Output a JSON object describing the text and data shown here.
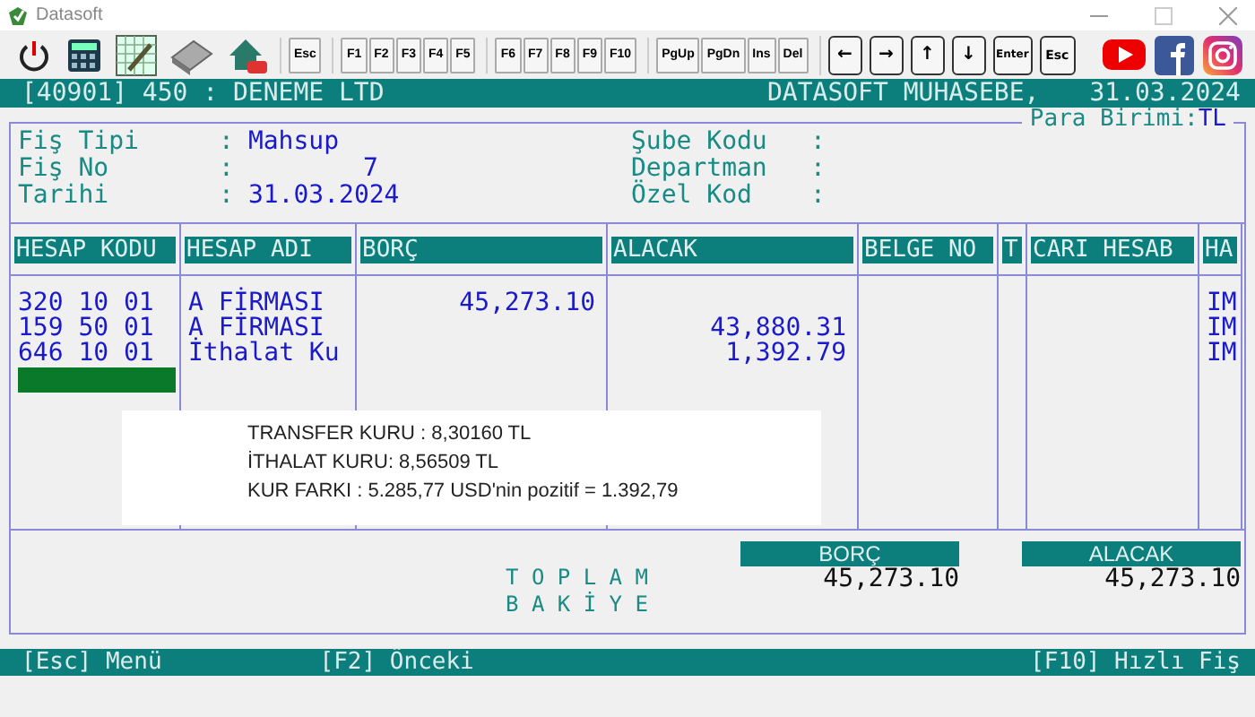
{
  "window": {
    "title": "Datasoft"
  },
  "toolbar": {
    "key_groups": [
      [
        "Esc"
      ],
      [
        "F1",
        "F2",
        "F3",
        "F4",
        "F5"
      ],
      [
        "F6",
        "F7",
        "F8",
        "F9",
        "F10"
      ],
      [
        "PgUp",
        "PgDn",
        "Ins",
        "Del"
      ]
    ],
    "arrow_keys": [
      "←",
      "→",
      "↑",
      "↓"
    ],
    "enter_key": "Enter",
    "esc_key": "Esc"
  },
  "header": {
    "company": "[40901] 450 : DENEME LTD",
    "app": "DATASOFT MUHASEBE,",
    "date": "31.03.2024"
  },
  "currency": {
    "label": "Para Birimi:",
    "value": "TL"
  },
  "fields_left": [
    {
      "label": "Fiş Tipi",
      "separator": ":",
      "value": "Mahsup"
    },
    {
      "label": "Fiş No",
      "separator": ":",
      "value": "7"
    },
    {
      "label": "Tarihi",
      "separator": ":",
      "value": "31.03.2024"
    }
  ],
  "fields_right": [
    {
      "label": "Şube Kodu",
      "separator": ":"
    },
    {
      "label": "Departman",
      "separator": ":"
    },
    {
      "label": "Özel Kod",
      "separator": ":"
    }
  ],
  "table": {
    "columns": [
      "HESAP KODU",
      "HESAP ADI",
      "BORÇ",
      "ALACAK",
      "BELGE NO",
      "T",
      "CARI HESAB",
      "HA"
    ],
    "rows": [
      {
        "hesap_kodu": "320 10 01",
        "hesap_adi": "A FİRMASI",
        "borc": "45,273.10",
        "ha": "IM"
      },
      {
        "hesap_kodu": "159 50 01",
        "hesap_adi": "A FİRMASI",
        "alacak": "43,880.31",
        "ha": "IM"
      },
      {
        "hesap_kodu": "646 10 01",
        "hesap_adi": "İthalat Ku",
        "alacak": "1,392.79",
        "ha": "IM"
      }
    ],
    "new_row_cursor": true
  },
  "note": [
    "TRANSFER KURU : 8,30160 TL",
    "İTHALAT KURU: 8,56509 TL",
    "KUR FARKI : 5.285,77 USD'nin pozitif = 1.392,79"
  ],
  "totals": {
    "label_1": "T O P L A M",
    "label_2": "B A K İ Y E",
    "debit_label": "BORÇ",
    "debit": "45,273.10",
    "credit_label": "ALACAK",
    "credit": "45,273.10"
  },
  "status_bar": [
    "[Esc] Menü",
    "[F2] Önceki",
    "[F10] Hızlı Fiş"
  ]
}
